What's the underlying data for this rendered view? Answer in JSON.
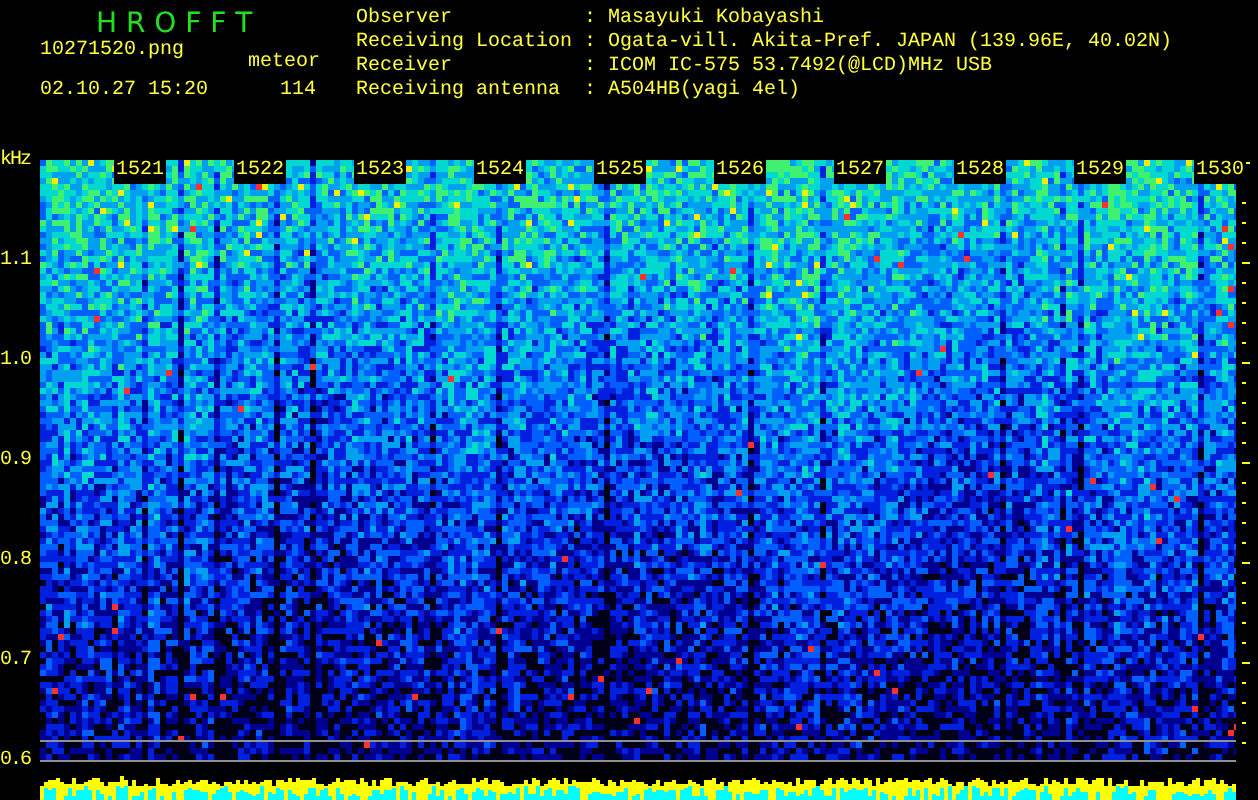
{
  "app_title": "H R O F F T",
  "file_name": "10271520.png",
  "datetime": "02.10.27 15:20",
  "counter_label": "meteor",
  "counter_value": "114",
  "station_info": [
    {
      "label": "Observer",
      "separator": ":",
      "value": "Masayuki Kobayashi"
    },
    {
      "label": "Receiving Location",
      "separator": ":",
      "value": "Ogata-vill. Akita-Pref. JAPAN (139.96E, 40.02N)"
    },
    {
      "label": "Receiver",
      "separator": ":",
      "value": "ICOM IC-575 53.7492(@LCD)MHz USB"
    },
    {
      "label": "Receiving antenna",
      "separator": ":",
      "value": "A504HB(yagi 4el)"
    }
  ],
  "spectrogram": {
    "y_unit": "kHz",
    "y_labels": [
      "1.1",
      "1.0",
      "0.9",
      "0.8",
      "0.7",
      "0.6"
    ],
    "time_labels": [
      "1521",
      "1522",
      "1523",
      "1524",
      "1525",
      "1526",
      "1527",
      "1528",
      "1529",
      "1530"
    ]
  }
}
